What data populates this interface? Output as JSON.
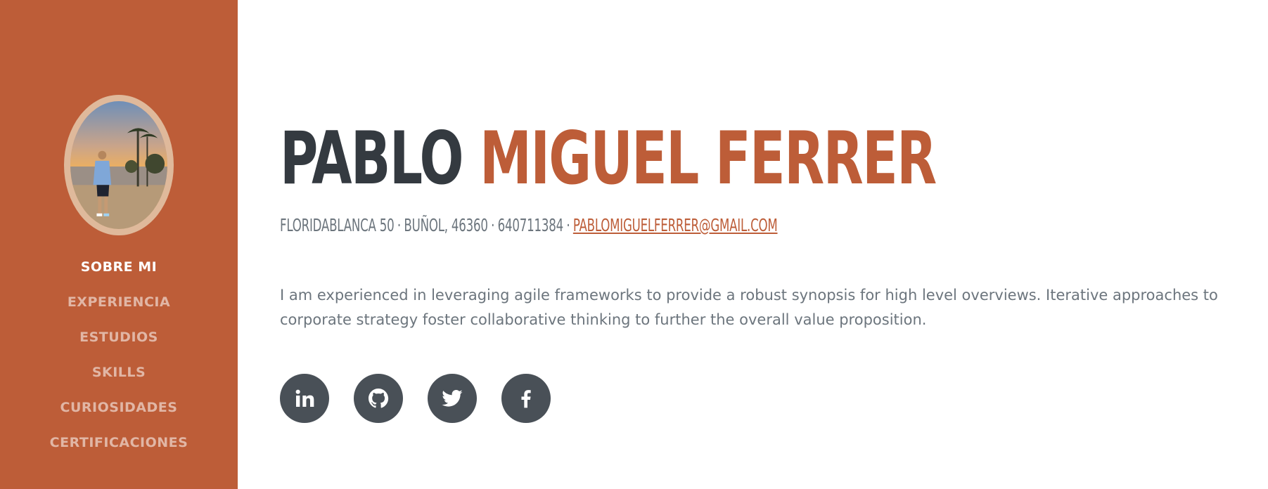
{
  "sidebar": {
    "photo_alt": "profile photo",
    "nav": [
      {
        "label": "SOBRE MI",
        "active": true
      },
      {
        "label": "EXPERIENCIA",
        "active": false
      },
      {
        "label": "ESTUDIOS",
        "active": false
      },
      {
        "label": "SKILLS",
        "active": false
      },
      {
        "label": "CURIOSIDADES",
        "active": false
      },
      {
        "label": "CERTIFICACIONES",
        "active": false
      }
    ]
  },
  "header": {
    "first_name": "PABLO",
    "last_name": "MIGUEL FERRER"
  },
  "contact": {
    "address": "FLORIDABLANCA 50",
    "city": "BUÑOL, 46360",
    "phone": "640711384",
    "separator": "·",
    "email": "PABLOMIGUELFERRER@GMAIL.COM"
  },
  "bio": "I am experienced in leveraging agile frameworks to provide a robust synopsis for high level overviews. Iterative approaches to corporate strategy foster collaborative thinking to further the overall value proposition.",
  "socials": [
    {
      "icon": "linkedin-icon"
    },
    {
      "icon": "github-icon"
    },
    {
      "icon": "twitter-icon"
    },
    {
      "icon": "facebook-icon"
    }
  ],
  "colors": {
    "primary": "#bd5d38",
    "heading": "#343a40",
    "muted": "#6c757d",
    "social_bg": "#495057"
  }
}
